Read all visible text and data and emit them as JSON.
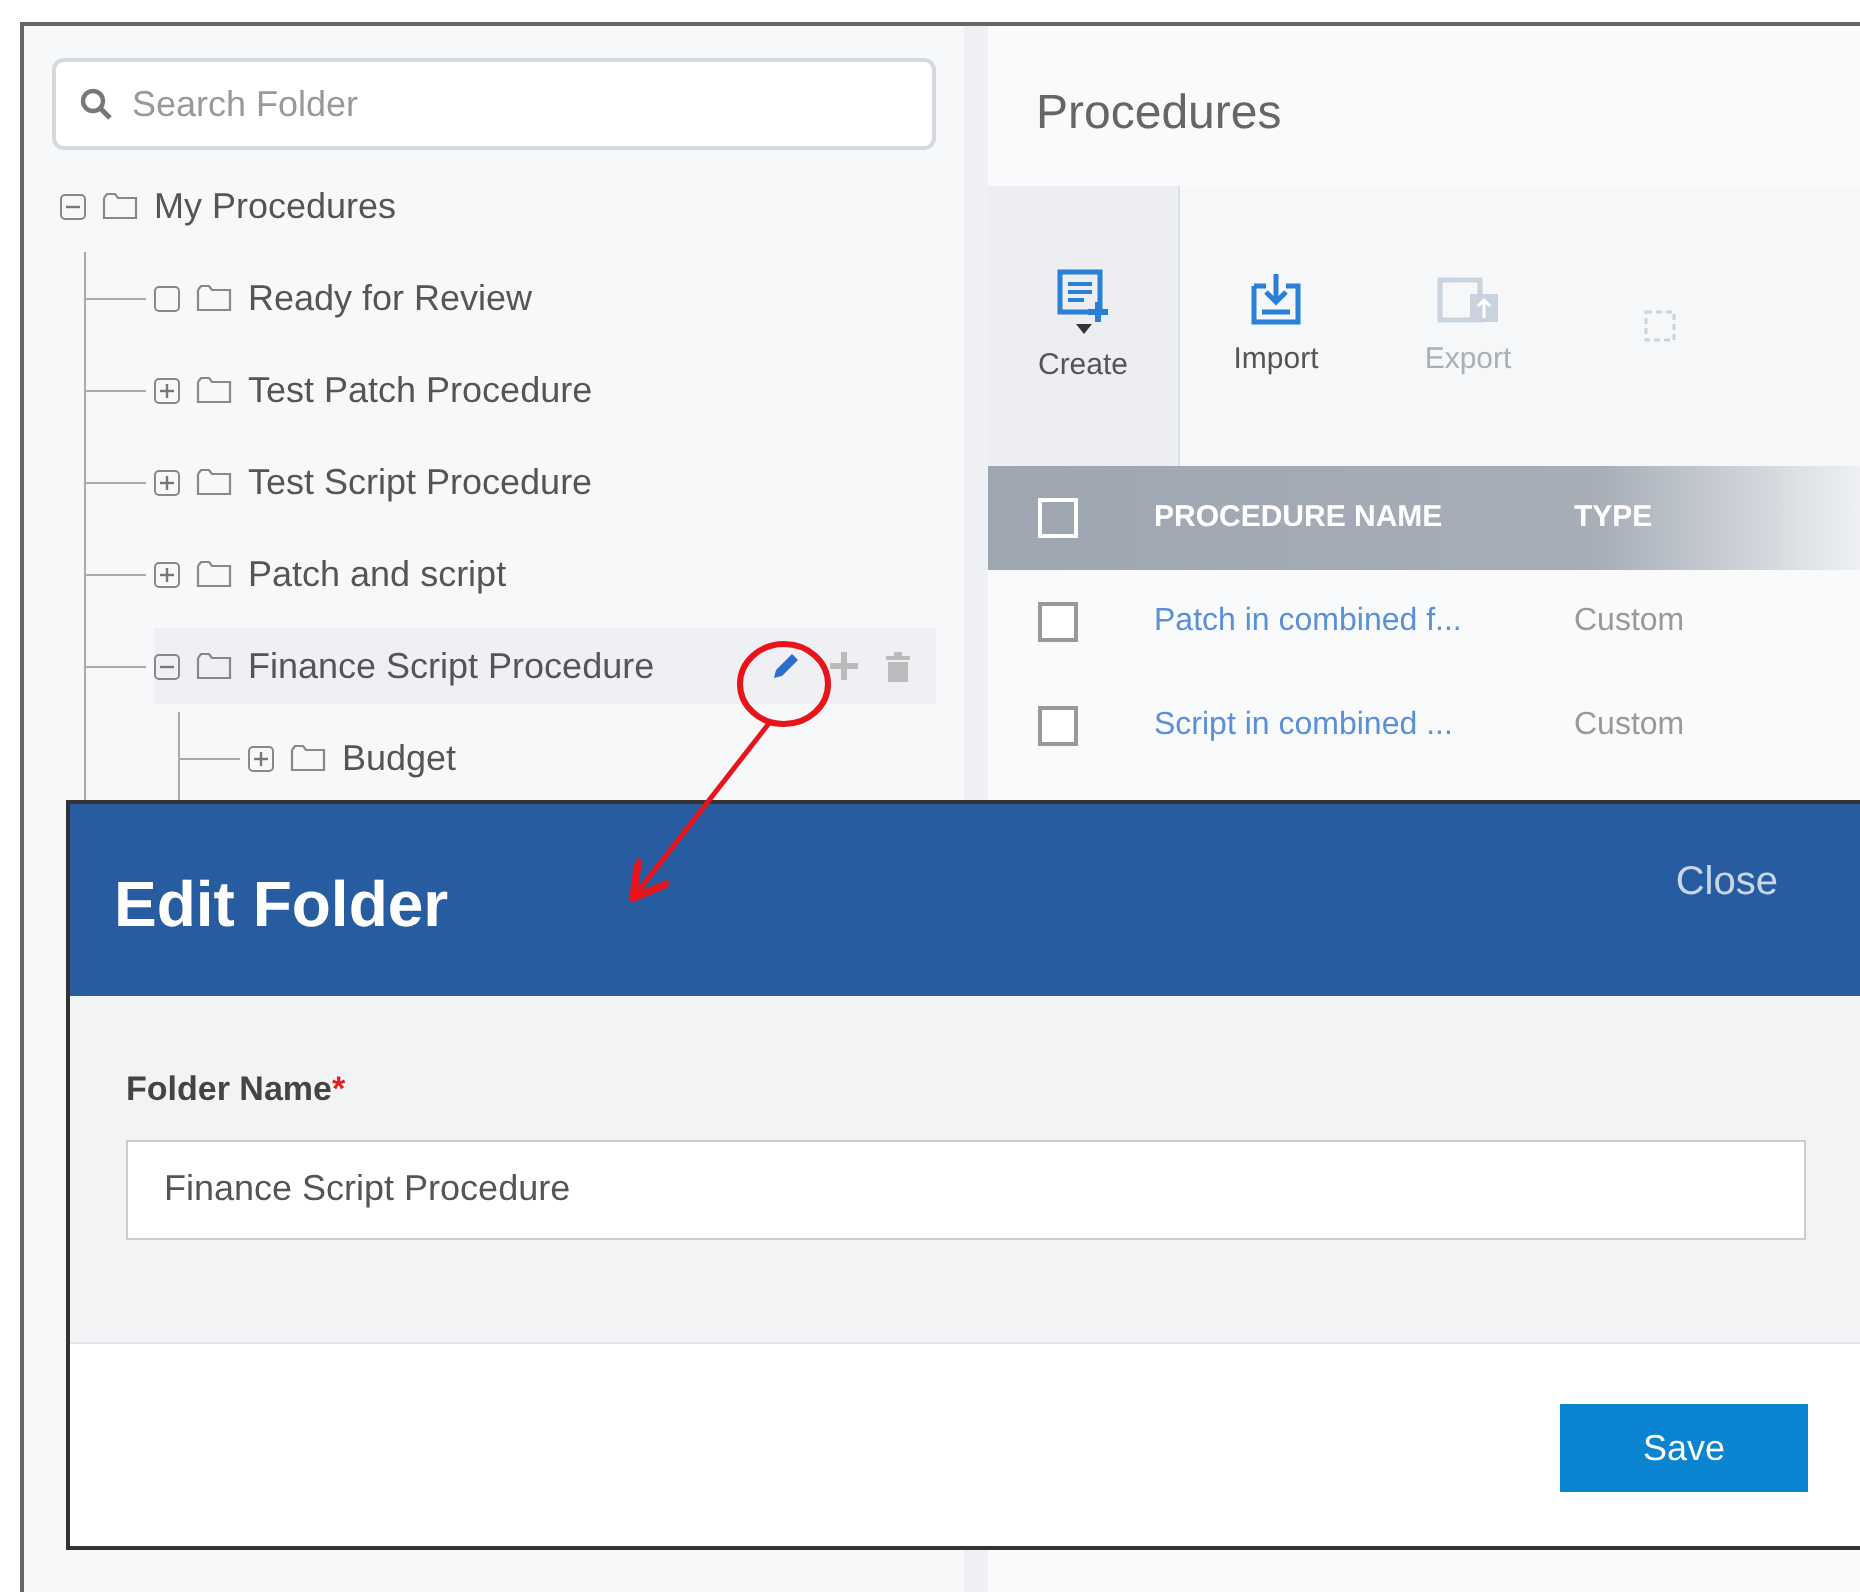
{
  "search": {
    "placeholder": "Search Folder"
  },
  "tree": [
    {
      "label": "My Procedures",
      "kind": "branch",
      "expanded": true,
      "selected": false,
      "children": [
        {
          "label": "Ready for Review",
          "kind": "leaf",
          "selected": false
        },
        {
          "label": "Test Patch Procedure",
          "kind": "branch",
          "expanded": false,
          "selected": false
        },
        {
          "label": "Test Script Procedure",
          "kind": "branch",
          "expanded": false,
          "selected": false
        },
        {
          "label": "Patch and script",
          "kind": "branch",
          "expanded": false,
          "selected": false
        },
        {
          "label": "Finance Script Procedure",
          "kind": "branch",
          "expanded": true,
          "selected": true,
          "children": [
            {
              "label": "Budget",
              "kind": "branch",
              "expanded": false,
              "selected": false
            }
          ]
        }
      ]
    }
  ],
  "main": {
    "title": "Procedures",
    "toolbar": [
      {
        "label": "Create",
        "kind": "create",
        "disabled": false,
        "dropdown": true
      },
      {
        "label": "Import",
        "kind": "import",
        "disabled": false,
        "dropdown": false
      },
      {
        "label": "Export",
        "kind": "export",
        "disabled": true,
        "dropdown": false
      },
      {
        "kind": "blank",
        "disabled": true,
        "dropdown": false
      }
    ],
    "table": {
      "all_checked": false,
      "columns": [
        "PROCEDURE NAME",
        "TYPE"
      ],
      "rows": [
        {
          "checked": false,
          "cells": [
            "Patch in combined f...",
            "Custom"
          ]
        },
        {
          "checked": false,
          "cells": [
            "Script in combined ...",
            "Custom"
          ]
        }
      ]
    }
  },
  "dialog": {
    "title": "Edit Folder",
    "close": "Close",
    "field_label": "Folder Name",
    "required_mark": "*",
    "value": "Finance Script Procedure",
    "save": "Save"
  }
}
